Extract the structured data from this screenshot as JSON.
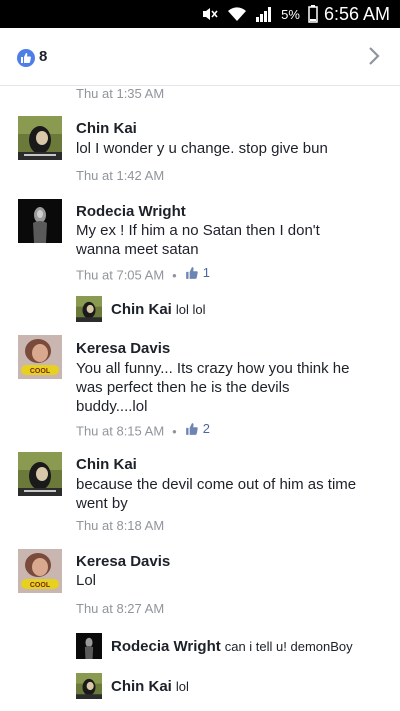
{
  "status_bar": {
    "battery": "5%",
    "time": "6:56 AM"
  },
  "header": {
    "like_count": "8"
  },
  "top_timestamp": "Thu at 1:35 AM",
  "comments": [
    {
      "name": "Chin Kai",
      "text": "lol I wonder y u change. stop give bun",
      "time": "Thu at 1:42 AM"
    },
    {
      "name": "Rodecia Wright",
      "text_lines": [
        "My ex ! If him a no Satan then I don't",
        "wanna meet satan"
      ],
      "time": "Thu at 7:05 AM",
      "likes": "1",
      "reply": {
        "name": "Chin Kai",
        "text": "lol lol"
      }
    },
    {
      "name": "Keresa Davis",
      "text_lines": [
        "You all funny... Its crazy how you think he",
        "was perfect then he is the devils",
        "buddy....lol"
      ],
      "time": "Thu at 8:15 AM",
      "likes": "2"
    },
    {
      "name": "Chin Kai",
      "text_lines": [
        "because the devil come out of him as time",
        "went by"
      ],
      "time": "Thu at 8:18 AM"
    },
    {
      "name": "Keresa Davis",
      "text": "Lol",
      "time": "Thu at 8:27 AM",
      "replies": [
        {
          "name": "Rodecia Wright",
          "text": "can i tell u! demonBoy"
        },
        {
          "name": "Chin Kai",
          "text": "lol"
        }
      ]
    }
  ],
  "colors": {
    "accent": "#4b67a1",
    "like_badge": "#4f7ee8",
    "meta": "#90949c"
  },
  "icons": [
    "mute-icon",
    "wifi-icon",
    "signal-icon",
    "battery-icon",
    "like-badge-icon",
    "chevron-right-icon",
    "thumbs-up-icon"
  ]
}
